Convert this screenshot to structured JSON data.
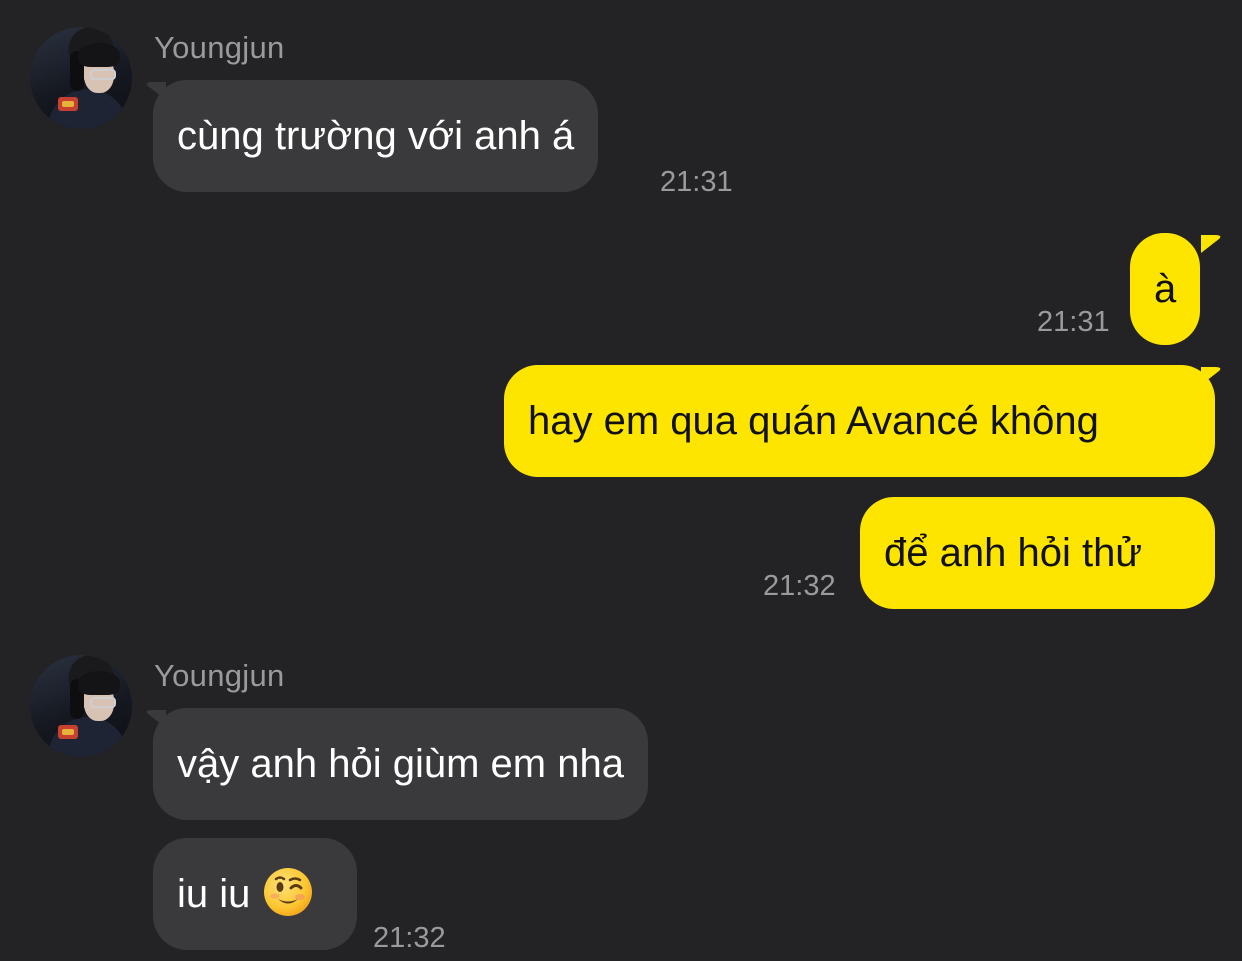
{
  "messages": [
    {
      "side": "in",
      "sender": "Youngjun",
      "text": "cùng trường với anh á",
      "time": "21:31"
    },
    {
      "side": "out",
      "text": "à",
      "time": "21:31"
    },
    {
      "side": "out",
      "text": "hay em qua quán Avancé không",
      "time": ""
    },
    {
      "side": "out",
      "text": "để anh hỏi thử",
      "time": "21:32"
    },
    {
      "side": "in",
      "sender": "Youngjun",
      "text": "vậy anh hỏi giùm em nha",
      "time": ""
    },
    {
      "side": "in",
      "text": "iu iu",
      "emoji": "winking-face-emoji",
      "time": "21:32"
    }
  ],
  "colors": {
    "background": "#232325",
    "incoming_bubble": "#3a3a3c",
    "outgoing_bubble": "#fee500",
    "meta_text": "#9a9a9e"
  }
}
